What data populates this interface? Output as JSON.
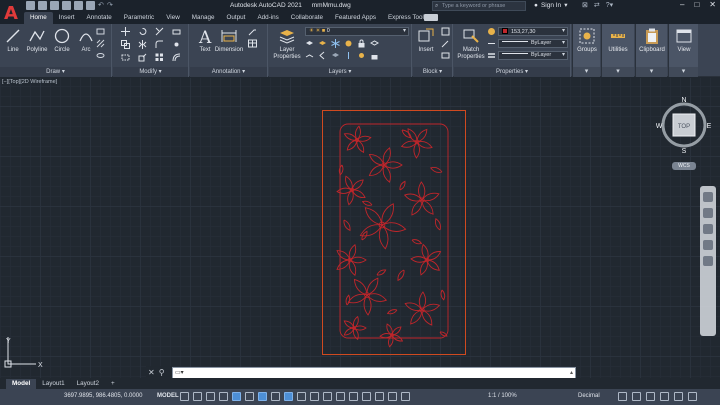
{
  "app": {
    "logo_letter": "A",
    "title": "Autodesk AutoCAD 2021",
    "file": "mmMmu.dwg"
  },
  "search": {
    "placeholder": "Type a keyword or phrase"
  },
  "account": {
    "signin_label": "Sign In"
  },
  "tabs": [
    {
      "label": "Home",
      "active": true
    },
    {
      "label": "Insert"
    },
    {
      "label": "Annotate"
    },
    {
      "label": "Parametric"
    },
    {
      "label": "View"
    },
    {
      "label": "Manage"
    },
    {
      "label": "Output"
    },
    {
      "label": "Add-ins"
    },
    {
      "label": "Collaborate"
    },
    {
      "label": "Featured Apps"
    },
    {
      "label": "Express Tools"
    }
  ],
  "ribbon": {
    "draw": {
      "title": "Draw",
      "line": "Line",
      "polyline": "Polyline",
      "circle": "Circle",
      "arc": "Arc"
    },
    "modify": {
      "title": "Modify"
    },
    "annotation": {
      "title": "Annotation",
      "text": "Text",
      "dimension": "Dimension"
    },
    "layers": {
      "title": "Layers",
      "layer_properties": "Layer Properties",
      "current_layer": "0"
    },
    "block": {
      "title": "Block",
      "insert": "Insert"
    },
    "properties": {
      "title": "Properties",
      "match": "Match Properties",
      "color_value": "153,27,30",
      "linetype": "ByLayer",
      "lineweight": "ByLayer"
    },
    "groups": "Groups",
    "utilities": "Utilities",
    "clipboard": "Clipboard",
    "view": "View"
  },
  "viewport": {
    "label": "[−][Top][2D Wireframe]",
    "viewcube": {
      "north": "N",
      "south": "S",
      "east": "E",
      "west": "W",
      "face": "TOP",
      "wcs": "WCS"
    },
    "ucs": {
      "x": "X",
      "y": "Y"
    }
  },
  "command": {
    "prompt": ""
  },
  "layout_tabs": [
    {
      "label": "Model",
      "active": true
    },
    {
      "label": "Layout1"
    },
    {
      "label": "Layout2"
    },
    {
      "label": "+"
    }
  ],
  "status": {
    "coordinates": "3697.9895, 986.4805, 0.0000",
    "model": "MODEL",
    "scale": "1:1 / 100%",
    "units": "Decimal"
  },
  "colors": {
    "drawing_stroke": "#c0262b",
    "frame_stroke": "#d04a20",
    "accent": "#4d8fd6"
  }
}
